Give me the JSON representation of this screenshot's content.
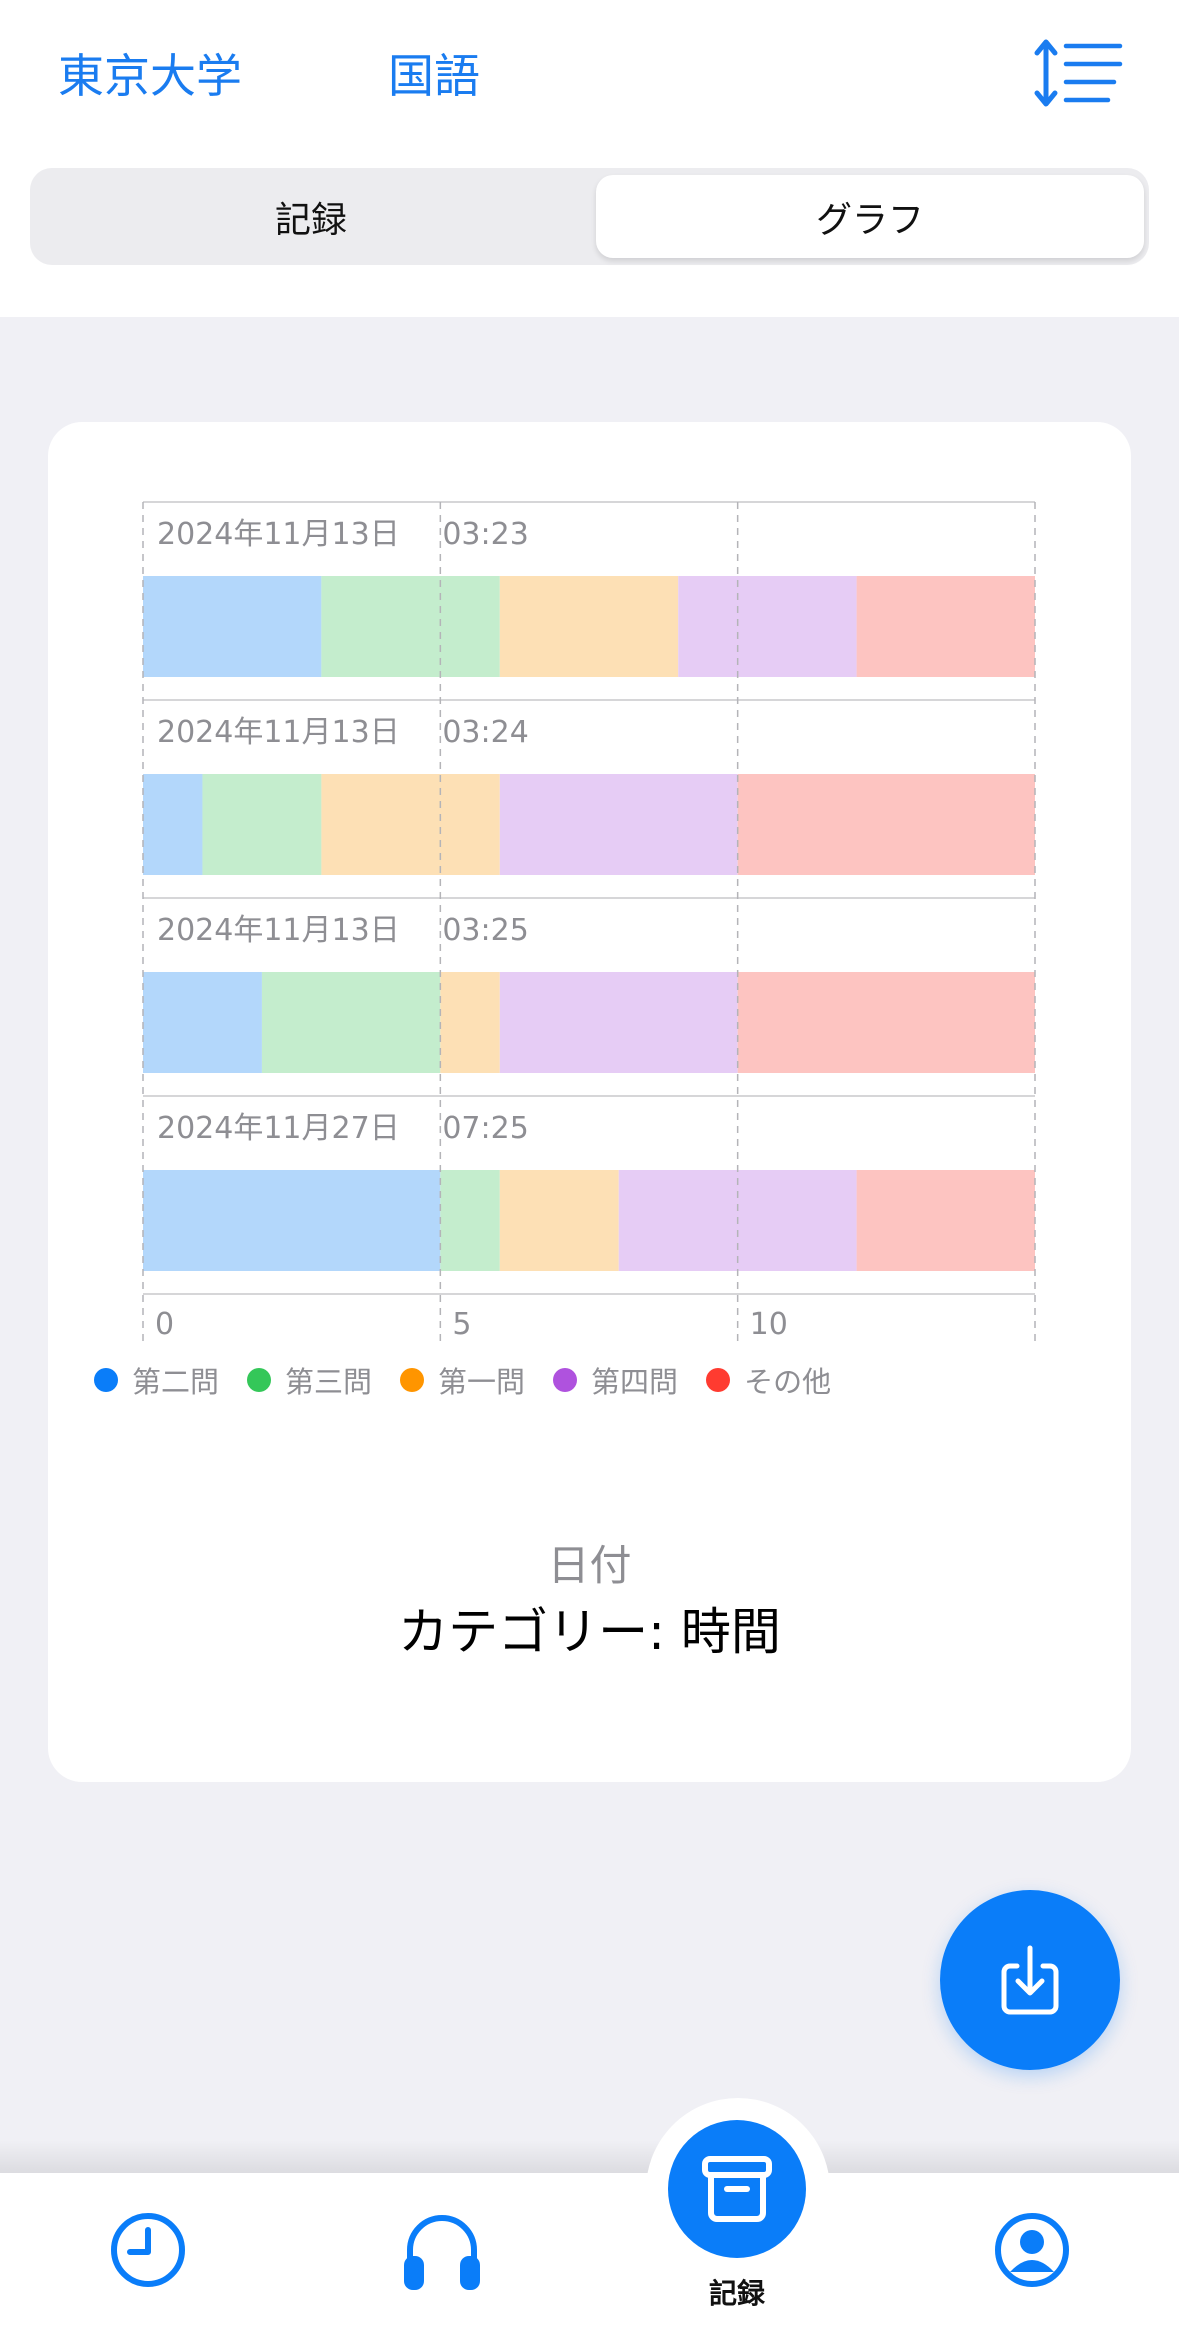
{
  "header": {
    "school": "東京大学",
    "subject": "国語",
    "sort_icon": "sort-lines-icon"
  },
  "segments": [
    {
      "label": "記録"
    },
    {
      "label": "グラフ",
      "selected": true
    }
  ],
  "chart_data": {
    "type": "bar",
    "orientation": "horizontal",
    "stacked": true,
    "categories": [
      "2024年11月13日 03:23",
      "2024年11月13日 03:24",
      "2024年11月13日 03:25",
      "2024年11月27日 07:25"
    ],
    "row_labels": [
      {
        "date": "2024年11月13日",
        "time": "03:23"
      },
      {
        "date": "2024年11月13日",
        "time": "03:24"
      },
      {
        "date": "2024年11月13日",
        "time": "03:25"
      },
      {
        "date": "2024年11月27日",
        "time": "07:25"
      }
    ],
    "series": [
      {
        "name": "第二問",
        "color": "#b3d7fb",
        "dot_color": "#0a7df9",
        "values": [
          3,
          1,
          2,
          5
        ]
      },
      {
        "name": "第三問",
        "color": "#c4edcd",
        "dot_color": "#34c759",
        "values": [
          3,
          2,
          3,
          1
        ]
      },
      {
        "name": "第一問",
        "color": "#fde0b5",
        "dot_color": "#ff9500",
        "values": [
          3,
          3,
          1,
          2
        ]
      },
      {
        "name": "第四問",
        "color": "#e6ccf5",
        "dot_color": "#af52de",
        "values": [
          3,
          4,
          4,
          4
        ]
      },
      {
        "name": "その他",
        "color": "#fdc4c1",
        "dot_color": "#ff3b30",
        "values": [
          3,
          5,
          5,
          3
        ]
      }
    ],
    "x_ticks": [
      0,
      5,
      10
    ],
    "xlim": [
      0,
      15
    ],
    "xlabel": "日付",
    "grid": true,
    "legend_position": "bottom-left"
  },
  "category_caption": "カテゴリー: 時間",
  "fab": {
    "icon": "download-tray-icon"
  },
  "tabbar": {
    "items": [
      {
        "icon": "clock-icon"
      },
      {
        "icon": "headphones-icon"
      },
      {
        "icon": "archive-box-icon",
        "label": "記録",
        "selected": true
      },
      {
        "icon": "person-circle-icon"
      }
    ]
  }
}
